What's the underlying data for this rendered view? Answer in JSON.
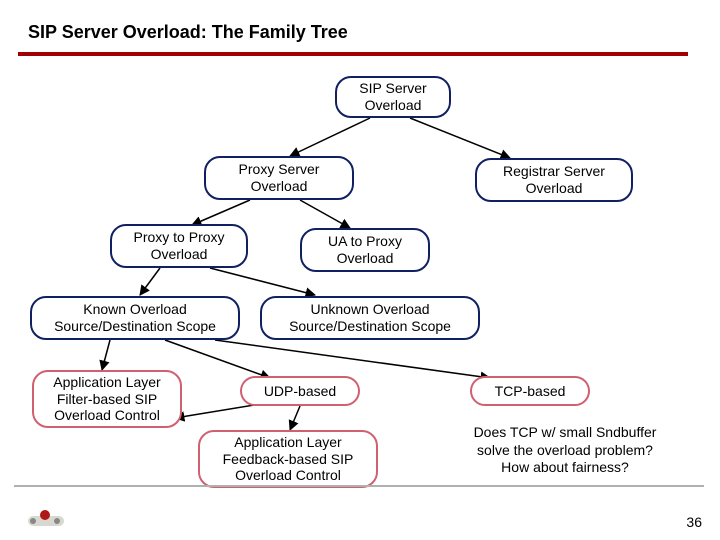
{
  "title": "SIP Server Overload: The Family Tree",
  "slide_number": "36",
  "nodes": {
    "root": "SIP Server\nOverload",
    "proxy_server": "Proxy Server\nOverload",
    "registrar": "Registrar Server\nOverload",
    "proxy_to_proxy": "Proxy to Proxy\nOverload",
    "ua_to_proxy": "UA to Proxy\nOverload",
    "known_scope": "Known Overload\nSource/Destination Scope",
    "unknown_scope": "Unknown Overload\nSource/Destination Scope",
    "app_filter": "Application Layer\nFilter-based SIP\nOverload Control",
    "udp": "UDP-based",
    "tcp": "TCP-based",
    "app_feedback": "Application Layer\nFeedback-based SIP\nOverload Control"
  },
  "annotations": {
    "tcp_q": "Does TCP w/ small Sndbuffer\nsolve the overload problem?\nHow about fairness?"
  },
  "colors": {
    "navy": "#102060",
    "pink": "#d06070",
    "rule": "#a00000"
  },
  "chart_data": {
    "type": "tree",
    "edges": [
      [
        "root",
        "proxy_server"
      ],
      [
        "root",
        "registrar"
      ],
      [
        "proxy_server",
        "proxy_to_proxy"
      ],
      [
        "proxy_server",
        "ua_to_proxy"
      ],
      [
        "proxy_to_proxy",
        "known_scope"
      ],
      [
        "proxy_to_proxy",
        "unknown_scope"
      ],
      [
        "known_scope",
        "app_filter"
      ],
      [
        "known_scope",
        "udp"
      ],
      [
        "known_scope",
        "tcp"
      ],
      [
        "udp",
        "app_feedback"
      ],
      [
        "udp",
        "app_filter"
      ]
    ]
  }
}
